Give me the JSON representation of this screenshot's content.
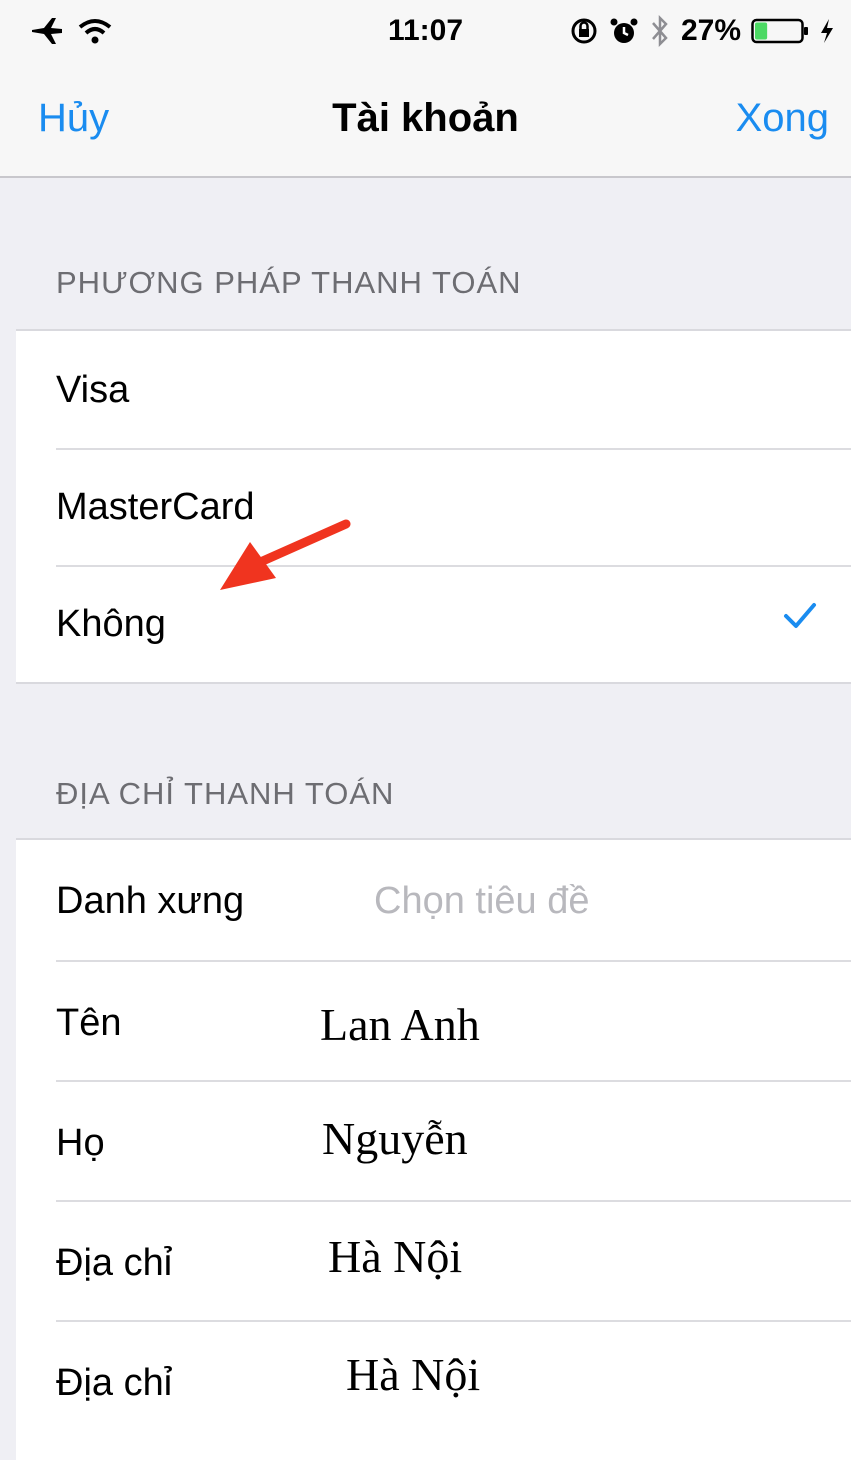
{
  "status_bar": {
    "time": "11:07",
    "battery_percent": "27%",
    "battery_level": 0.27,
    "icons": [
      "airplane-icon",
      "wifi-icon",
      "rotation-lock-icon",
      "alarm-icon",
      "bluetooth-icon",
      "battery-icon",
      "charging-icon"
    ]
  },
  "nav": {
    "cancel": "Hủy",
    "title": "Tài khoản",
    "done": "Xong"
  },
  "payment": {
    "header": "PHƯƠNG PHÁP THANH TOÁN",
    "options": [
      "Visa",
      "MasterCard",
      "Không"
    ],
    "selected": "Không"
  },
  "billing": {
    "header": "ĐỊA CHỈ THANH TOÁN",
    "salutation_label": "Danh xưng",
    "salutation_placeholder": "Chọn tiêu đề",
    "first_name_label": "Tên",
    "first_name_value": "Lan Anh",
    "last_name_label": "Họ",
    "last_name_value": "Nguyễn",
    "address1_label": "Địa chỉ",
    "address1_value": "Hà Nội",
    "address2_label": "Địa chỉ",
    "address2_value": "Hà Nội"
  },
  "colors": {
    "accent": "#1a8cf0",
    "annotation_arrow": "#f0341f"
  }
}
